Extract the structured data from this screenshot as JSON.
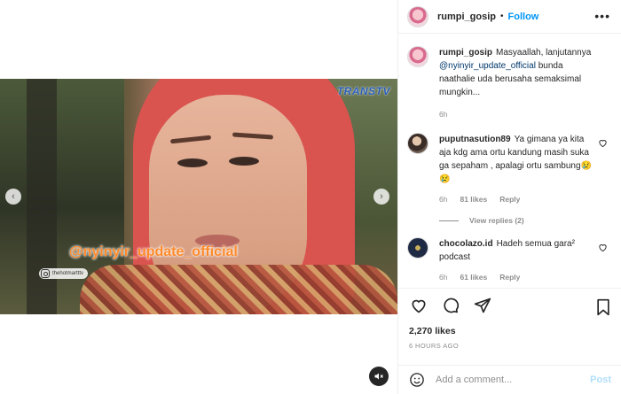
{
  "post": {
    "username": "rumpi_gosip",
    "follow_label": "Follow",
    "more_label": "•••"
  },
  "media": {
    "watermark": "@nyinyir_update_official",
    "channel_logo": "TRANSTV",
    "ig_handle": "thehotmartttv",
    "prev_label": "‹",
    "next_label": "›",
    "mute_icon": "mute-icon"
  },
  "caption": {
    "author": "rumpi_gosip",
    "text_before": "Masyaallah, lanjutannya ",
    "mention": "@nyinyir_update_official",
    "text_after": " bunda naathalie uda berusaha semaksimal mungkin...",
    "time": "6h"
  },
  "comments": [
    {
      "author": "puputnasution89",
      "text": "Ya gimana ya kita aja kdg ama ortu kandung masih suka ga sepaham , apalagi ortu sambung😢😢",
      "time": "6h",
      "likes": "81 likes",
      "reply_label": "Reply",
      "view_replies": "View replies (2)"
    },
    {
      "author": "chocolazo.id",
      "text": "Hadeh semua gara² podcast",
      "time": "6h",
      "likes": "61 likes",
      "reply_label": "Reply"
    }
  ],
  "likes_count": "2,270 likes",
  "timestamp": "6 HOURS AGO",
  "add_comment": {
    "placeholder": "Add a comment...",
    "post_label": "Post"
  },
  "colors": {
    "accent": "#0095f6",
    "text": "#262626",
    "muted": "#8e8e8e",
    "post_disabled": "#b2dffc"
  }
}
